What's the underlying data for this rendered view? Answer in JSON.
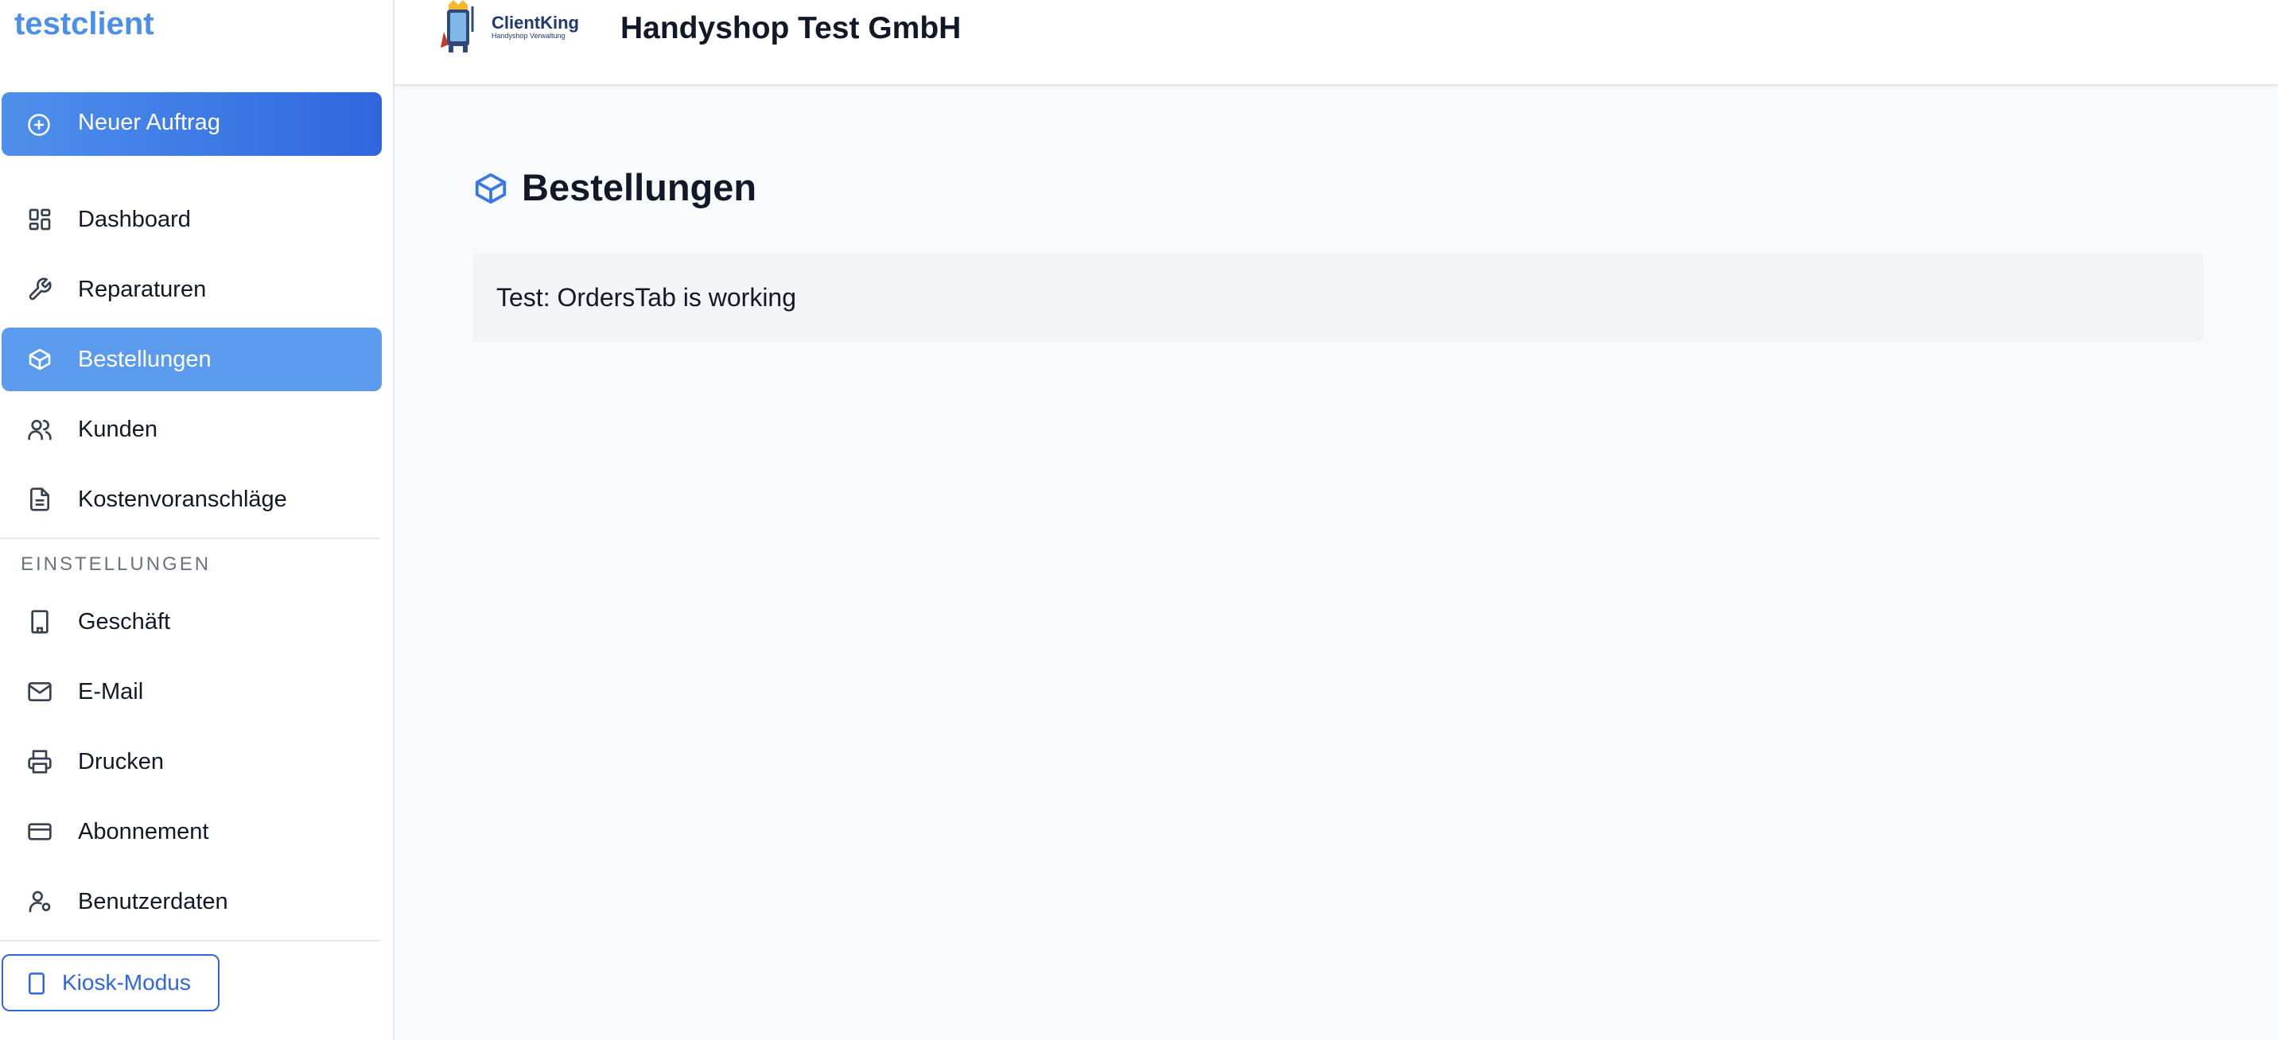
{
  "sidebar": {
    "brand": "testclient",
    "new_order_label": "Neuer Auftrag",
    "items": [
      {
        "label": "Dashboard",
        "icon": "dashboard-icon"
      },
      {
        "label": "Reparaturen",
        "icon": "wrench-icon"
      },
      {
        "label": "Bestellungen",
        "icon": "package-icon",
        "active": true
      },
      {
        "label": "Kunden",
        "icon": "users-icon"
      },
      {
        "label": "Kostenvoranschläge",
        "icon": "document-icon"
      }
    ],
    "settings_label": "EINSTELLUNGEN",
    "settings_items": [
      {
        "label": "Geschäft",
        "icon": "building-icon"
      },
      {
        "label": "E-Mail",
        "icon": "mail-icon"
      },
      {
        "label": "Drucken",
        "icon": "printer-icon"
      },
      {
        "label": "Abonnement",
        "icon": "credit-card-icon"
      },
      {
        "label": "Benutzerdaten",
        "icon": "user-settings-icon"
      }
    ],
    "kiosk_label": "Kiosk-Modus"
  },
  "header": {
    "logo_text": "ClientKing",
    "logo_subtext": "Handyshop Verwaltung",
    "company_name": "Handyshop Test GmbH"
  },
  "main": {
    "page_title": "Bestellungen",
    "page_icon": "package-icon",
    "test_message": "Test: OrdersTab is working"
  },
  "colors": {
    "accent": "#3b78e4",
    "active_nav": "#5a9bee",
    "brand_text": "#4c8fe8"
  }
}
